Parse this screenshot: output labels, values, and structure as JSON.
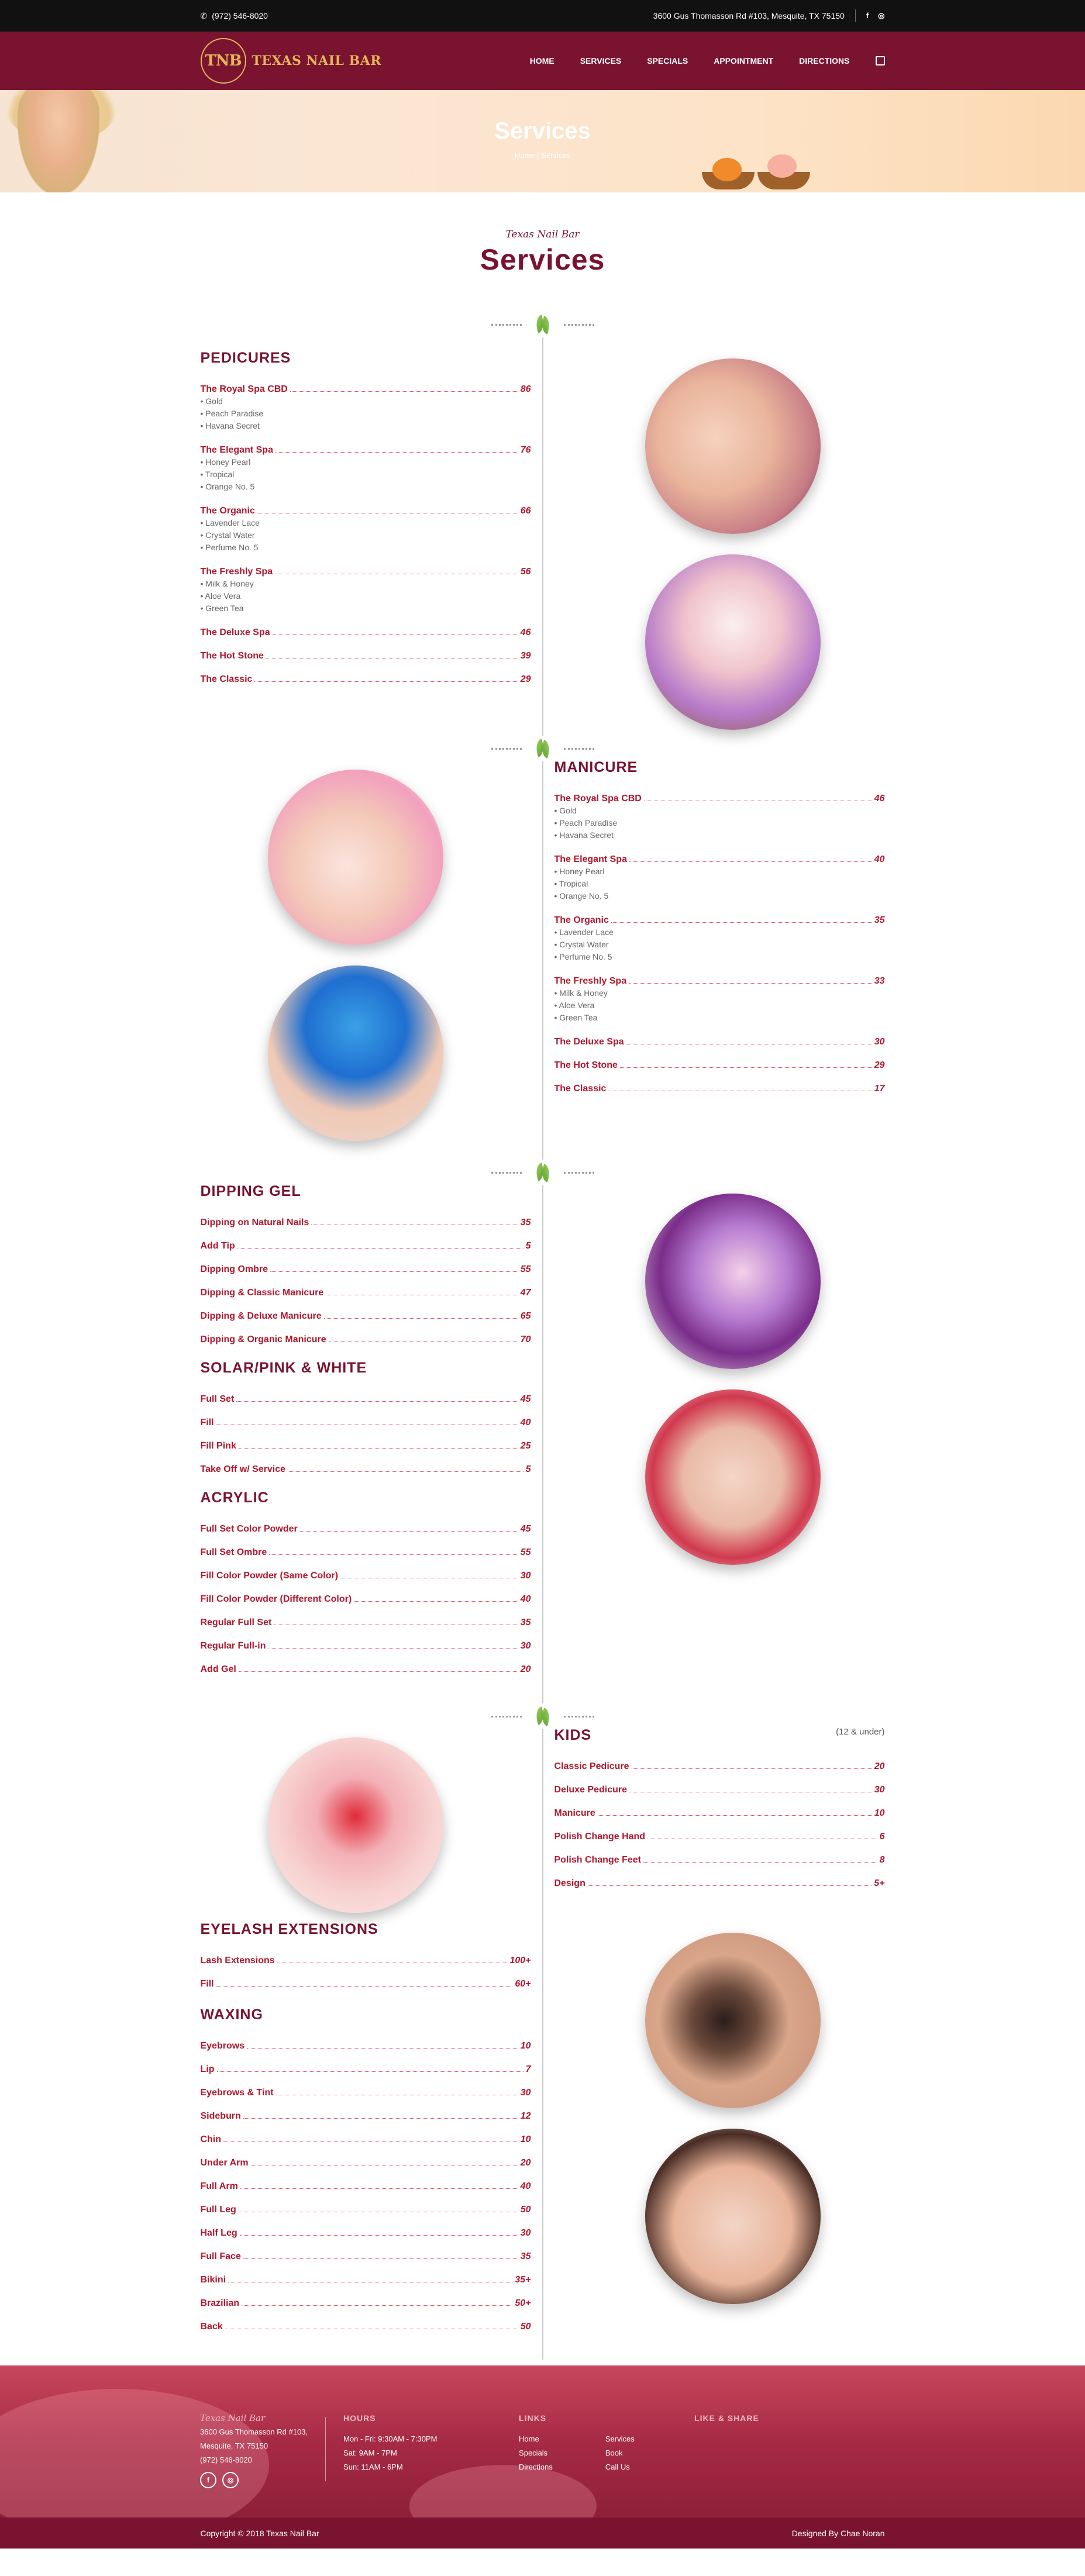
{
  "topbar": {
    "phone": "(972) 546-8020",
    "address": "3600 Gus Thomasson Rd #103, Mesquite, TX 75150",
    "facebook": "f",
    "instagram": "◎"
  },
  "nav": {
    "logo_mark": "TNB",
    "logo_text": "TEXAS NAIL BAR",
    "items": [
      "HOME",
      "SERVICES",
      "SPECIALS",
      "APPOINTMENT",
      "DIRECTIONS"
    ]
  },
  "hero": {
    "title": "Services",
    "breadcrumb": "Home | Services"
  },
  "section": {
    "script": "Texas Nail Bar",
    "title": "Services"
  },
  "pedicures": {
    "title": "PEDICURES",
    "items": [
      {
        "name": "The Royal Spa CBD",
        "price": "86",
        "subs": "• Gold\n• Peach Paradise\n• Havana Secret"
      },
      {
        "name": "The Elegant Spa",
        "price": "76",
        "subs": "• Honey Pearl\n• Tropical\n• Orange No. 5"
      },
      {
        "name": "The Organic",
        "price": "66",
        "subs": "• Lavender Lace\n• Crystal Water\n• Perfume No. 5"
      },
      {
        "name": "The Freshly Spa",
        "price": "56",
        "subs": "• Milk & Honey\n• Aloe Vera\n• Green Tea"
      },
      {
        "name": "The Deluxe Spa",
        "price": "46"
      },
      {
        "name": "The Hot Stone",
        "price": "39"
      },
      {
        "name": "The Classic",
        "price": "29"
      }
    ]
  },
  "manicure": {
    "title": "MANICURE",
    "items": [
      {
        "name": "The Royal Spa CBD",
        "price": "46",
        "subs": "• Gold\n• Peach Paradise\n• Havana Secret"
      },
      {
        "name": "The Elegant Spa",
        "price": "40",
        "subs": "• Honey Pearl\n• Tropical\n• Orange No. 5"
      },
      {
        "name": "The Organic",
        "price": "35",
        "subs": "• Lavender Lace\n• Crystal Water\n• Perfume No. 5"
      },
      {
        "name": "The Freshly Spa",
        "price": "33",
        "subs": "• Milk & Honey\n• Aloe Vera\n• Green Tea"
      },
      {
        "name": "The Deluxe Spa",
        "price": "30"
      },
      {
        "name": "The Hot Stone",
        "price": "29"
      },
      {
        "name": "The Classic",
        "price": "17"
      }
    ]
  },
  "dipping": {
    "title": "DIPPING GEL",
    "items": [
      {
        "name": "Dipping on Natural Nails",
        "price": "35"
      },
      {
        "name": "Add Tip",
        "price": "5"
      },
      {
        "name": "Dipping Ombre",
        "price": "55"
      },
      {
        "name": "Dipping & Classic Manicure",
        "price": "47"
      },
      {
        "name": "Dipping & Deluxe Manicure",
        "price": "65"
      },
      {
        "name": "Dipping & Organic Manicure",
        "price": "70"
      }
    ]
  },
  "solar": {
    "title": "SOLAR/PINK & WHITE",
    "items": [
      {
        "name": "Full Set",
        "price": "45"
      },
      {
        "name": "Fill",
        "price": "40"
      },
      {
        "name": "Fill Pink",
        "price": "25"
      },
      {
        "name": "Take Off w/ Service",
        "price": "5"
      }
    ]
  },
  "acrylic": {
    "title": "ACRYLIC",
    "items": [
      {
        "name": "Full Set Color Powder",
        "price": "45"
      },
      {
        "name": "Full Set Ombre",
        "price": "55"
      },
      {
        "name": "Fill Color Powder (Same Color)",
        "price": "30"
      },
      {
        "name": "Fill Color Powder (Different Color)",
        "price": "40"
      },
      {
        "name": "Regular Full Set",
        "price": "35"
      },
      {
        "name": "Regular Full-in",
        "price": "30"
      },
      {
        "name": "Add Gel",
        "price": "20"
      }
    ]
  },
  "kids": {
    "title": "KIDS",
    "note": "(12 & under)",
    "items": [
      {
        "name": "Classic Pedicure",
        "price": "20"
      },
      {
        "name": "Deluxe Pedicure",
        "price": "30"
      },
      {
        "name": "Manicure",
        "price": "10"
      },
      {
        "name": "Polish Change Hand",
        "price": "6"
      },
      {
        "name": "Polish Change Feet",
        "price": "8"
      },
      {
        "name": "Design",
        "price": "5+"
      }
    ]
  },
  "eyelash": {
    "title": "EYELASH EXTENSIONS",
    "items": [
      {
        "name": "Lash Extensions",
        "price": "100+"
      },
      {
        "name": "Fill",
        "price": "60+"
      }
    ]
  },
  "waxing": {
    "title": "WAXING",
    "items": [
      {
        "name": "Eyebrows",
        "price": "10"
      },
      {
        "name": "Lip",
        "price": "7"
      },
      {
        "name": "Eyebrows & Tint",
        "price": "30"
      },
      {
        "name": "Sideburn",
        "price": "12"
      },
      {
        "name": "Chin",
        "price": "10"
      },
      {
        "name": "Under Arm",
        "price": "20"
      },
      {
        "name": "Full Arm",
        "price": "40"
      },
      {
        "name": "Full Leg",
        "price": "50"
      },
      {
        "name": "Half Leg",
        "price": "30"
      },
      {
        "name": "Full Face",
        "price": "35"
      },
      {
        "name": "Bikini",
        "price": "35+"
      },
      {
        "name": "Brazilian",
        "price": "50+"
      },
      {
        "name": "Back",
        "price": "50"
      }
    ]
  },
  "footer": {
    "brand": "Texas Nail Bar",
    "address1": "3600 Gus Thomasson Rd #103,",
    "address2": "Mesquite, TX 75150",
    "phone": "(972) 546-8020",
    "hours_title": "HOURS",
    "hours": [
      "Mon - Fri: 9:30AM - 7:30PM",
      "Sat: 9AM - 7PM",
      "Sun: 11AM - 6PM"
    ],
    "links_title": "LINKS",
    "links_col1": [
      "Home",
      "Specials",
      "Directions"
    ],
    "links_col2": [
      "Services",
      "Book",
      "Call Us"
    ],
    "share_title": "LIKE & SHARE"
  },
  "copyright": {
    "left": "Copyright © 2018 Texas Nail Bar",
    "right": "Designed By Chae Noran"
  }
}
